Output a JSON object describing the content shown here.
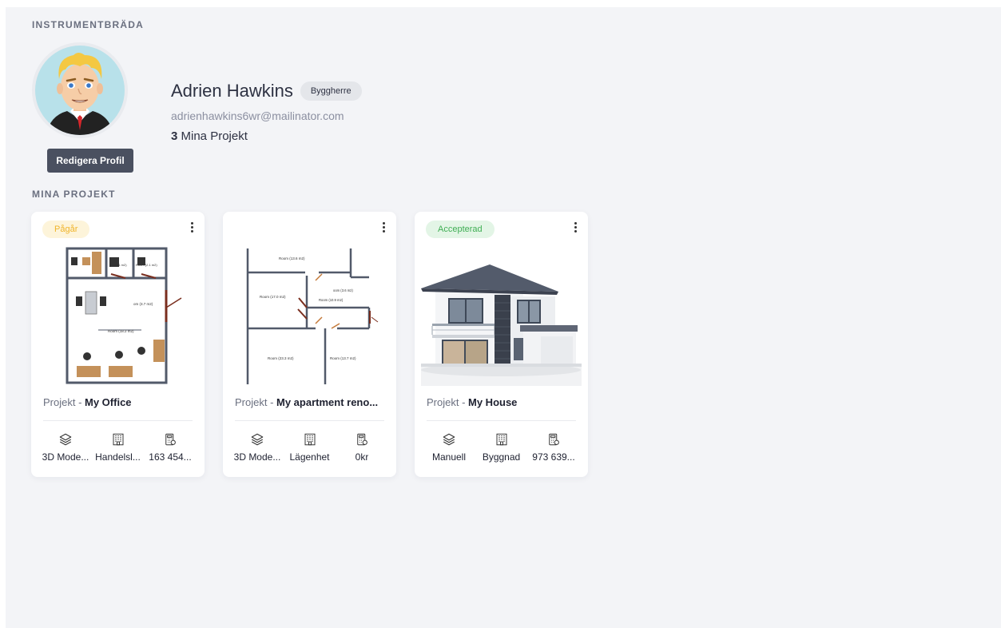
{
  "dashboard": {
    "title": "INSTRUMENTBRÄDA",
    "profile": {
      "name": "Adrien Hawkins",
      "role": "Byggherre",
      "email": "adrienhawkins6wr@mailinator.com",
      "project_count": "3",
      "project_count_label": "Mina Projekt",
      "edit_button": "Redigera Profil",
      "avatar_icon": "cartoon-businessman-avatar"
    }
  },
  "projects": {
    "title": "MINA PROJEKT",
    "title_prefix": "Projekt - ",
    "items": [
      {
        "status": "Pågår",
        "status_color": "#f0b429",
        "name": "My Office",
        "image": "office-floor-plan",
        "stats": [
          "3D Mode...",
          "Handelsl...",
          "163 454..."
        ]
      },
      {
        "status": "",
        "name": "My apartment reno...",
        "image": "apartment-floor-plan",
        "stats": [
          "3D Mode...",
          "Lägenhet",
          "0kr"
        ]
      },
      {
        "status": "Accepterad",
        "status_color": "#3fae54",
        "name": "My House",
        "image": "modern-house-photo",
        "stats": [
          "Manuell",
          "Byggnad",
          "973 639..."
        ]
      }
    ],
    "stat_icons": [
      "layers-icon",
      "building-icon",
      "calculator-icon"
    ]
  }
}
